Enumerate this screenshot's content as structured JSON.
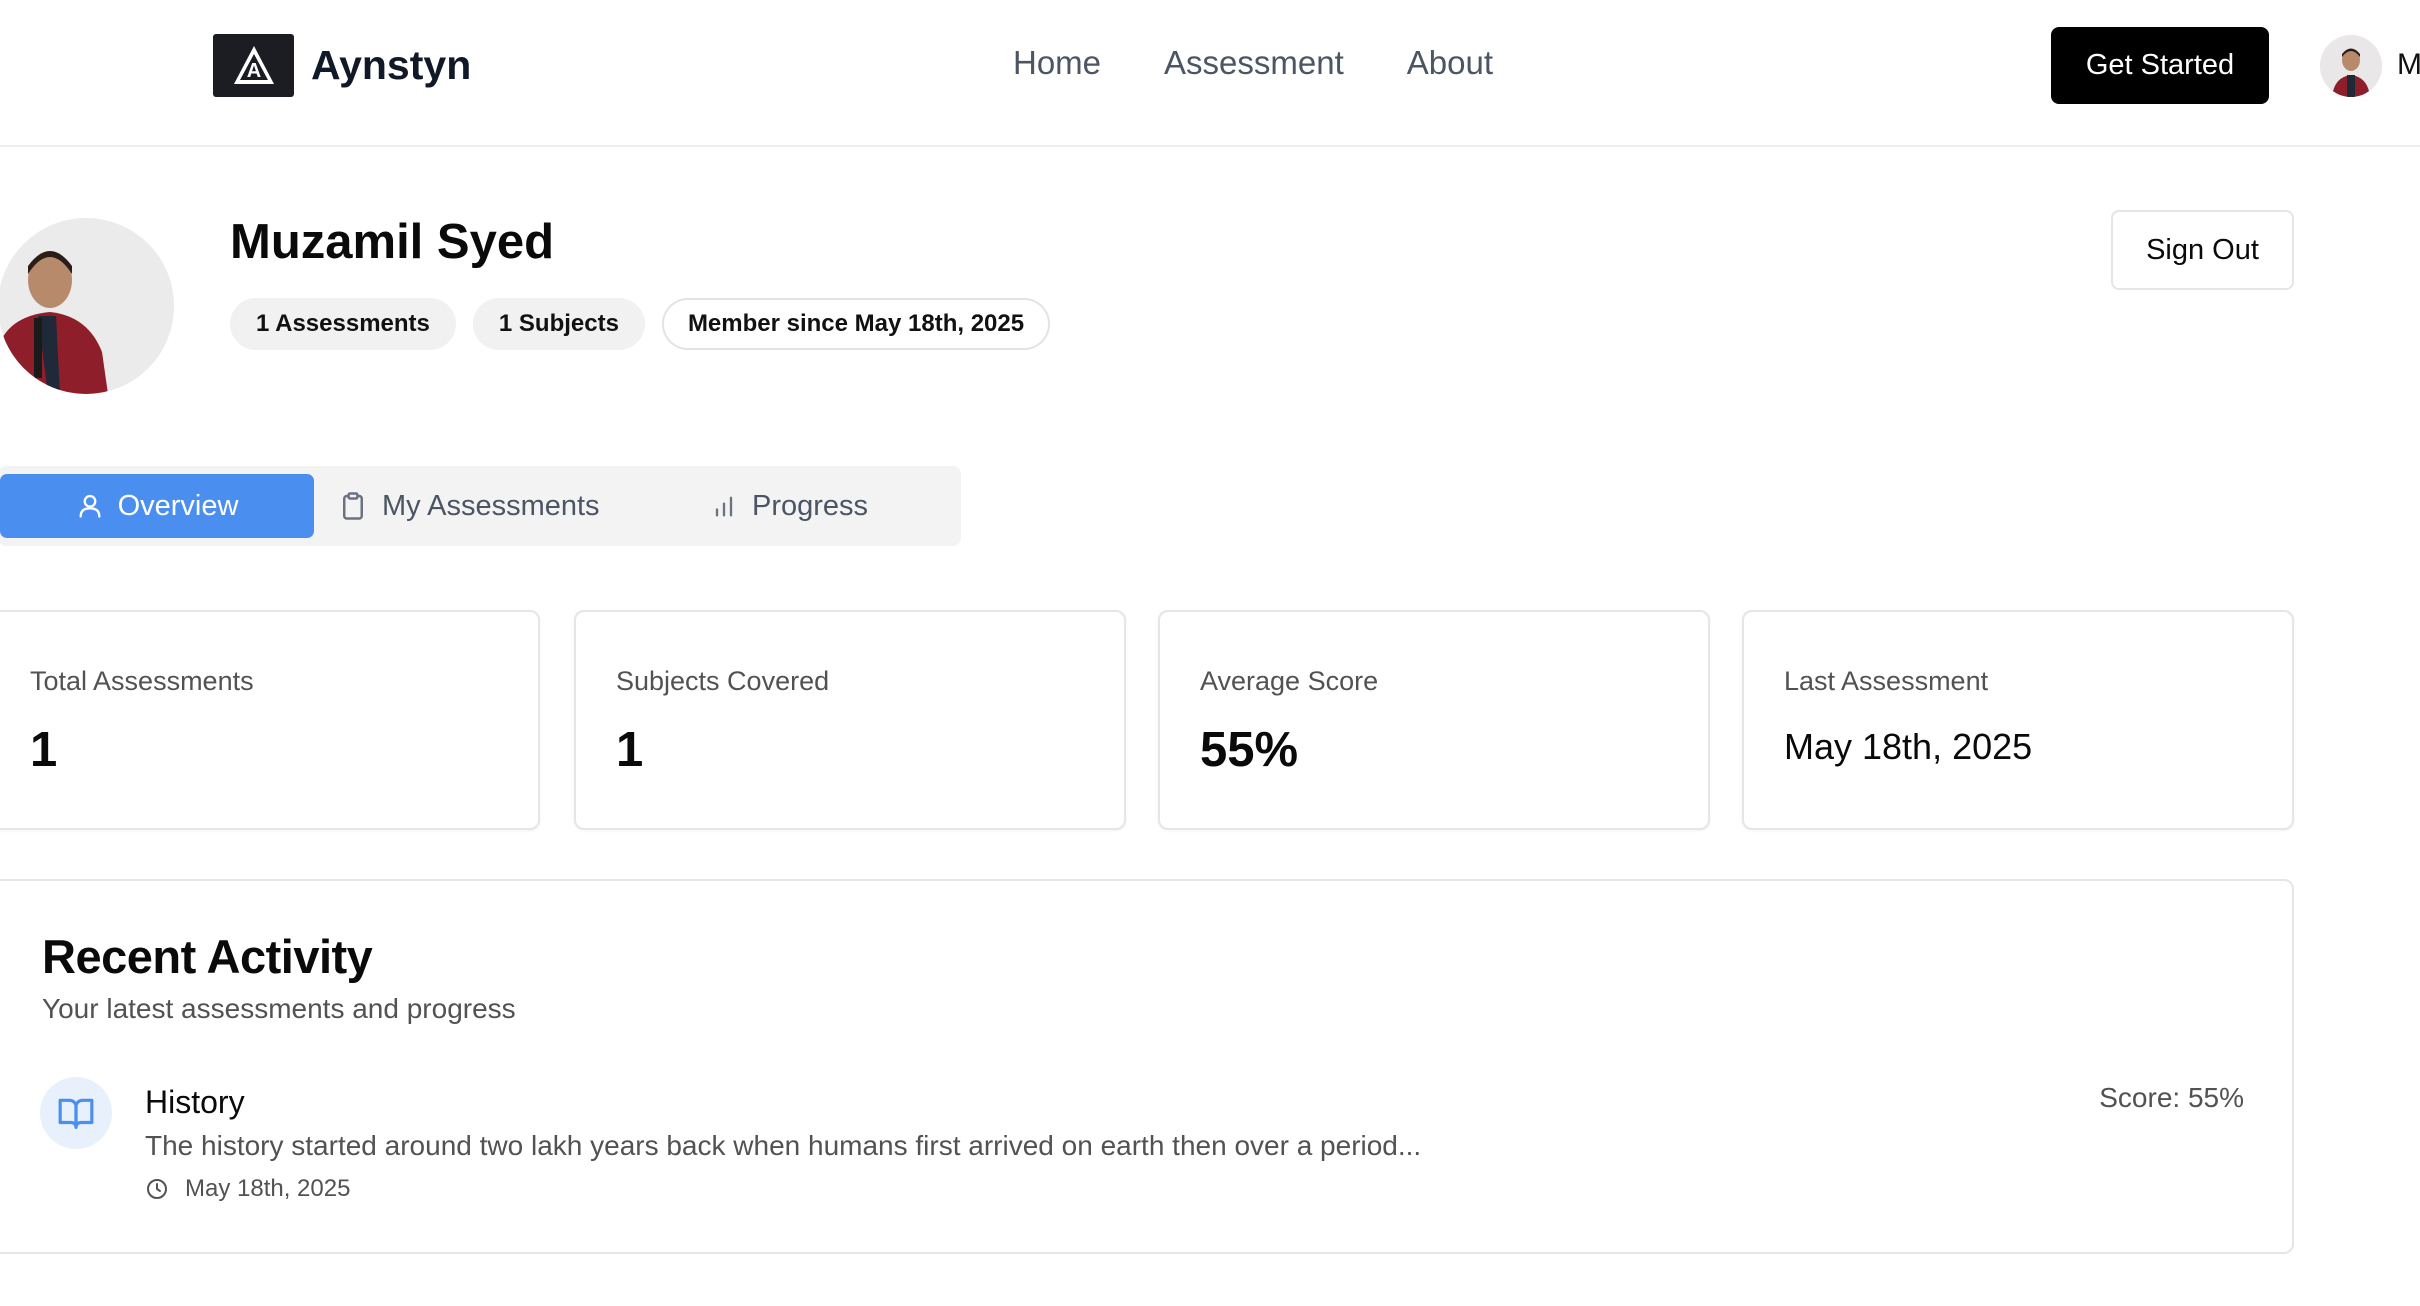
{
  "nav": {
    "brand": "Aynstyn",
    "links": [
      "Home",
      "Assessment",
      "About"
    ],
    "cta": "Get Started",
    "user_initial": "M"
  },
  "profile": {
    "name": "Muzamil Syed",
    "badges": [
      "1 Assessments",
      "1 Subjects",
      "Member since May 18th, 2025"
    ],
    "sign_out": "Sign Out"
  },
  "tabs": [
    {
      "label": "Overview",
      "icon": "user-icon",
      "active": true
    },
    {
      "label": "My Assessments",
      "icon": "clipboard-icon",
      "active": false
    },
    {
      "label": "Progress",
      "icon": "bar-chart-icon",
      "active": false
    }
  ],
  "stats": [
    {
      "label": "Total Assessments",
      "value": "1"
    },
    {
      "label": "Subjects Covered",
      "value": "1"
    },
    {
      "label": "Average Score",
      "value": "55%"
    },
    {
      "label": "Last Assessment",
      "value": "May 18th, 2025"
    }
  ],
  "recent_activity": {
    "title": "Recent Activity",
    "subtitle": "Your latest assessments and progress",
    "items": [
      {
        "subject": "History",
        "description": "The history started around two lakh years back when humans first arrived on earth then over a period...",
        "date": "May 18th, 2025",
        "score": "Score: 55%",
        "icon": "book-open-icon"
      }
    ]
  },
  "colors": {
    "accent": "#4a8ff0",
    "primary_button": "#000000",
    "icon_bg": "#e8f0fc"
  }
}
